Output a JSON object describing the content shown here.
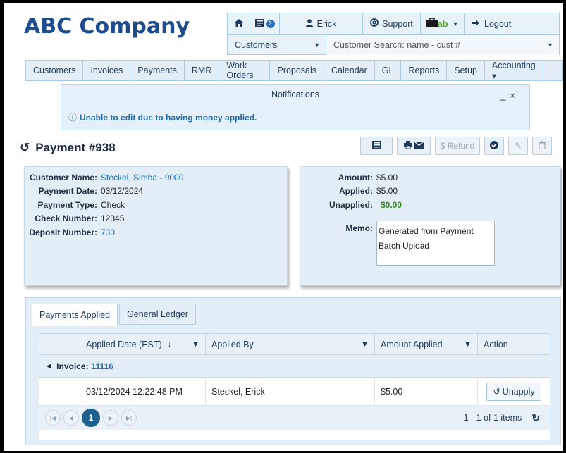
{
  "header": {
    "brand": "ABC Company",
    "user": "Erick",
    "support": "Support",
    "logout": "Logout",
    "news_badge": "2",
    "brief_label": "ab",
    "customer_select": "Customers",
    "search_placeholder": "Customer Search: name - cust #"
  },
  "nav": [
    "Customers",
    "Invoices",
    "Payments",
    "RMR",
    "Work Orders",
    "Proposals",
    "Calendar",
    "GL",
    "Reports",
    "Setup",
    "Accounting ▾"
  ],
  "notifications": {
    "title": "Notifications",
    "message": "Unable to edit due to having money applied."
  },
  "page": {
    "title": "Payment #938"
  },
  "toolbar": {
    "refund": "$ Refund"
  },
  "details_left": {
    "customer_name_label": "Customer Name:",
    "customer_name": "Steckel, Simba - 9000",
    "payment_date_label": "Payment Date:",
    "payment_date": "03/12/2024",
    "payment_type_label": "Payment Type:",
    "payment_type": "Check",
    "check_number_label": "Check Number:",
    "check_number": "12345",
    "deposit_number_label": "Deposit Number:",
    "deposit_number": "730"
  },
  "details_right": {
    "amount_label": "Amount:",
    "amount": "$5.00",
    "applied_label": "Applied:",
    "applied": "$5.00",
    "unapplied_label": "Unapplied:",
    "unapplied": "$0.00",
    "memo_label": "Memo:",
    "memo": "Generated from Payment Batch Upload"
  },
  "tabs": [
    "Payments Applied",
    "General Ledger"
  ],
  "grid": {
    "columns": [
      "Applied Date (EST)",
      "Applied By",
      "Amount Applied",
      "Action"
    ],
    "group_label": "Invoice:",
    "group_value": "11116",
    "rows": [
      {
        "date": "03/12/2024 12:22:48:PM",
        "by": "Steckel, Erick",
        "amount": "$5.00",
        "action": "Unapply"
      }
    ],
    "current_page": "1",
    "pager_info": "1 - 1 of 1 items"
  }
}
